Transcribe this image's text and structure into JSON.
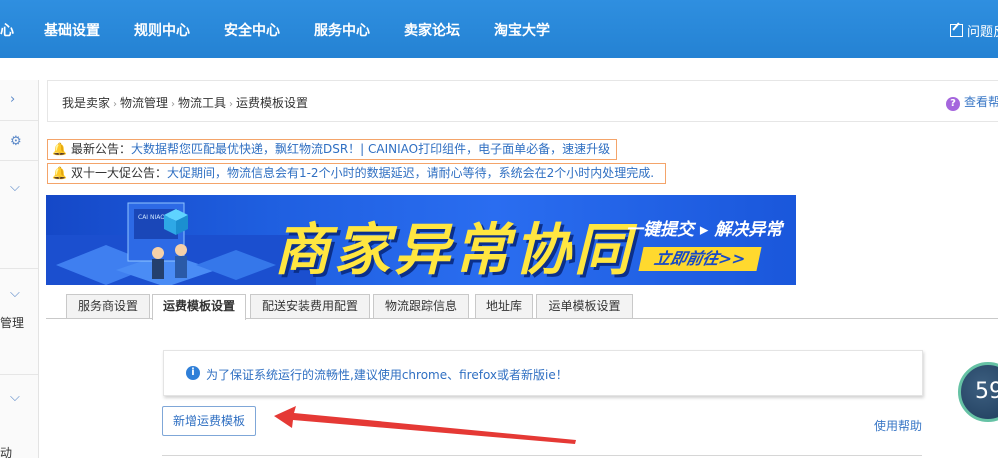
{
  "topnav": {
    "items": [
      "心",
      "基础设置",
      "规则中心",
      "安全中心",
      "服务中心",
      "卖家论坛",
      "淘宝大学"
    ],
    "feedback": "问题反"
  },
  "sidebar": {
    "truncated_label": "管理",
    "bottom_char": "动"
  },
  "breadcrumb": {
    "items": [
      "我是卖家",
      "物流管理",
      "物流工具",
      "运费模板设置"
    ],
    "help": "查看帮"
  },
  "notices": [
    {
      "label": "最新公告：",
      "message": "大数据帮您匹配最优快递，飘红物流DSR！| CAINIAO打印组件，电子面单必备，速速升级"
    },
    {
      "label": "双十一大促公告：",
      "message": "大促期间，物流信息会有1-2个小时的数据延迟，请耐心等待，系统会在2个小时内处理完成."
    }
  ],
  "banner": {
    "logo": "CAI NIAO 菜鸟",
    "headline": "商家异常协同",
    "subline": "一键提交 ▸ 解决异常",
    "cta": "立即前往>>"
  },
  "tabs": [
    {
      "label": "服务商设置",
      "active": false
    },
    {
      "label": "运费模板设置",
      "active": true
    },
    {
      "label": "配送安装费用配置",
      "active": false
    },
    {
      "label": "物流跟踪信息",
      "active": false
    },
    {
      "label": "地址库",
      "active": false
    },
    {
      "label": "运单模板设置",
      "active": false
    }
  ],
  "info": {
    "message": "为了保证系统运行的流畅性,建议使用chrome、firefox或者新版ie！"
  },
  "actions": {
    "add_template": "新增运费模板",
    "help": "使用帮助"
  },
  "badge": {
    "value": "59"
  },
  "colors": {
    "nav_bg": "#2b8ad9",
    "link_blue": "#2f6fc2",
    "notice_border": "#f4a46a",
    "banner_yellow": "#ffe640",
    "arrow_red": "#e53935"
  }
}
